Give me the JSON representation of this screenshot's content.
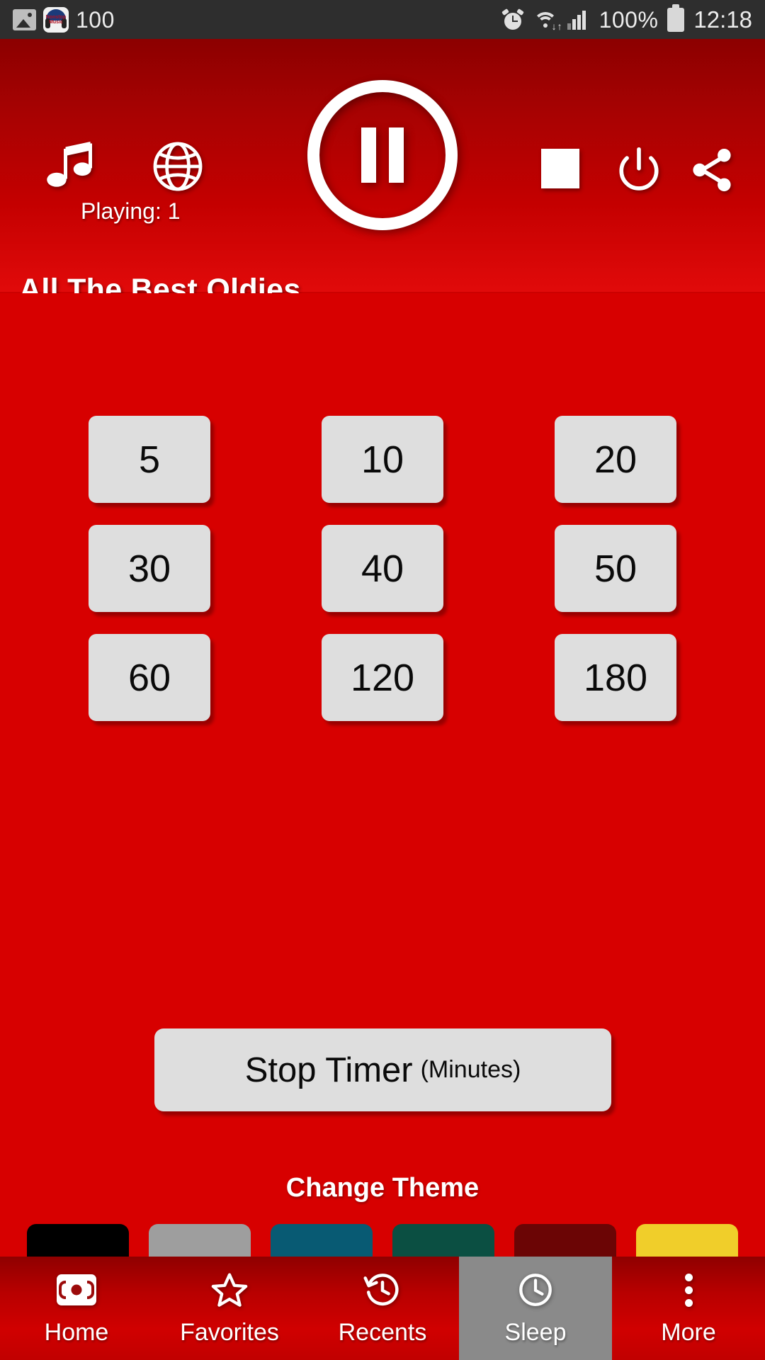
{
  "status_bar": {
    "notification_count": "100",
    "battery_percent": "100%",
    "time": "12:18",
    "icons": [
      "gallery-icon",
      "nonstop-music-app-icon",
      "alarm-icon",
      "wifi-icon",
      "signal-icon",
      "battery-icon"
    ],
    "app_icon_text_line1": "Nonstop",
    "app_icon_text_line2": "Music"
  },
  "header": {
    "music_icon": "music-note-icon",
    "globe_icon": "globe-icon",
    "playing_label": "Playing: 1",
    "play_pause_state": "pause-icon",
    "stop_icon": "stop-square-icon",
    "power_icon": "power-icon",
    "share_icon": "share-icon",
    "station_title": "All The Best Oldies"
  },
  "sleep_timer": {
    "rows": [
      [
        "5",
        "10",
        "20"
      ],
      [
        "30",
        "40",
        "50"
      ],
      [
        "60",
        "120",
        "180"
      ]
    ],
    "stop_label": "Stop Timer",
    "stop_unit": "(Minutes)"
  },
  "theme": {
    "title": "Change Theme",
    "swatches": [
      {
        "name": "black",
        "color": "#000000"
      },
      {
        "name": "grey",
        "color": "#9E9E9E"
      },
      {
        "name": "blue",
        "color": "#085A73"
      },
      {
        "name": "green",
        "color": "#0B4F42"
      },
      {
        "name": "maroon",
        "color": "#6B0505"
      },
      {
        "name": "yellow",
        "color": "#F0CE2A"
      }
    ]
  },
  "bottom_nav": {
    "items": [
      {
        "label": "Home",
        "icon": "radio-broadcast-icon",
        "active": false
      },
      {
        "label": "Favorites",
        "icon": "star-icon",
        "active": false
      },
      {
        "label": "Recents",
        "icon": "history-clock-icon",
        "active": false
      },
      {
        "label": "Sleep",
        "icon": "clock-icon",
        "active": true
      },
      {
        "label": "More",
        "icon": "overflow-dots-icon",
        "active": false
      }
    ]
  },
  "colors": {
    "accent_red": "#D70000",
    "header_dark": "#8C0000",
    "button_grey": "#DEDEDE",
    "status_bar": "#2E2E2E",
    "active_nav": "#8A8A8A"
  }
}
